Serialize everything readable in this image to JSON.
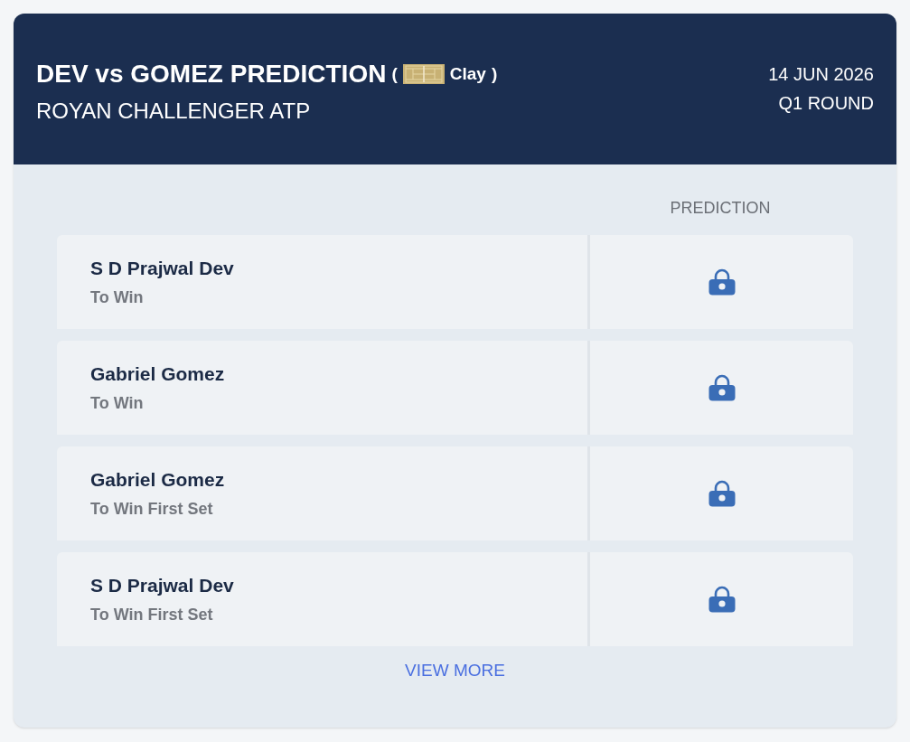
{
  "header": {
    "title": "DEV vs GOMEZ PREDICTION",
    "paren_open": "(",
    "surface": "Clay",
    "paren_close": ")",
    "tournament": "ROYAN CHALLENGER ATP",
    "date": "14 JUN 2026",
    "round": "Q1 ROUND"
  },
  "table": {
    "column_header": "PREDICTION",
    "rows": [
      {
        "player": "S D Prajwal Dev",
        "market": "To Win"
      },
      {
        "player": "Gabriel Gomez",
        "market": "To Win"
      },
      {
        "player": "Gabriel Gomez",
        "market": "To Win First Set"
      },
      {
        "player": "S D Prajwal Dev",
        "market": "To Win First Set"
      }
    ]
  },
  "footer": {
    "link": "VIEW MORE"
  }
}
